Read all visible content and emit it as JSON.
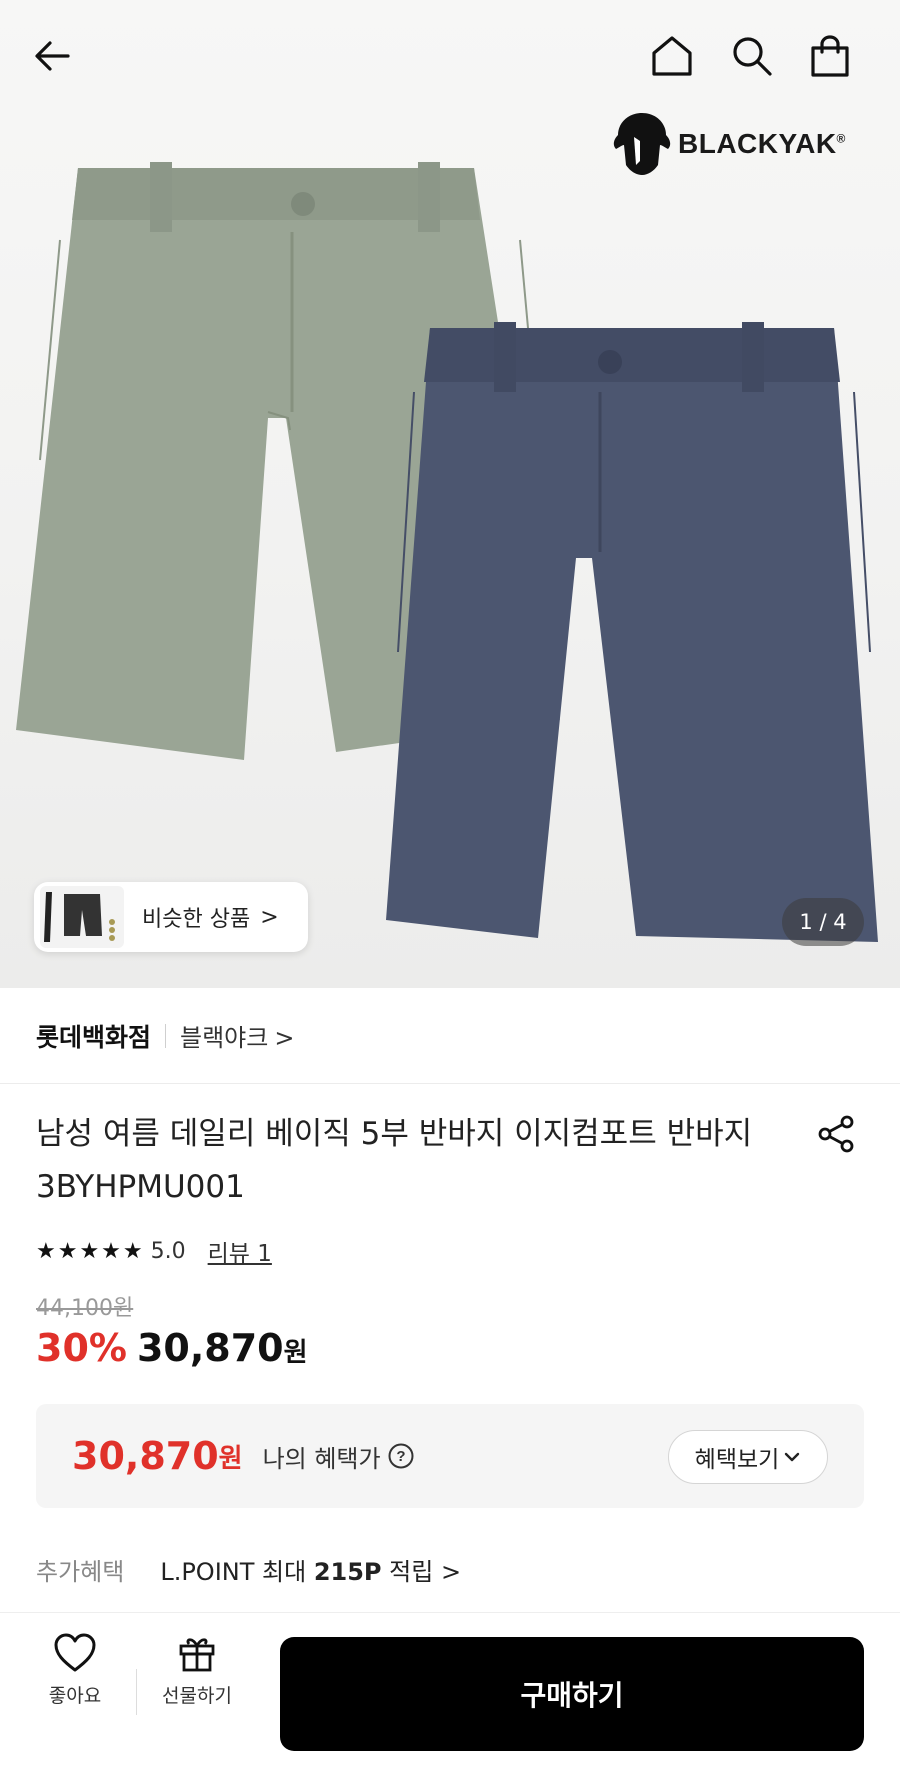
{
  "header": {
    "back_icon": "arrow-left-icon",
    "home_icon": "home-icon",
    "search_icon": "search-icon",
    "cart_icon": "shopping-bag-icon"
  },
  "brand_logo": {
    "text": "BLACKYAK",
    "mark": "®"
  },
  "gallery": {
    "similar_label": "비슷한 상품",
    "similar_chevron": ">",
    "counter": "1 / 4",
    "colors": {
      "green": "#9aa595",
      "navy": "#4c5670"
    }
  },
  "store": {
    "name": "롯데백화점",
    "brand": "블랙야크",
    "brand_chevron": ">"
  },
  "product": {
    "title": "남성 여름 데일리 베이직 5부 반바지 이지컴포트 반바지 3BYHPMU001",
    "stars": "★★★★★",
    "rating": "5.0",
    "review_link": "리뷰 1",
    "original_price": "44,100원",
    "discount": "30%",
    "sale_price": "30,870",
    "sale_unit": "원"
  },
  "benefit": {
    "price": "30,870",
    "unit": "원",
    "label": "나의 혜택가",
    "help_icon": "question-circle-icon",
    "button": "혜택보기"
  },
  "extra": {
    "label": "추가혜택",
    "text_prefix": "L.POINT 최대",
    "points": "215P",
    "text_suffix": "적립",
    "chevron": ">"
  },
  "bottom": {
    "like_label": "좋아요",
    "gift_label": "선물하기",
    "buy_label": "구매하기"
  },
  "accent_color": "#e0312a"
}
